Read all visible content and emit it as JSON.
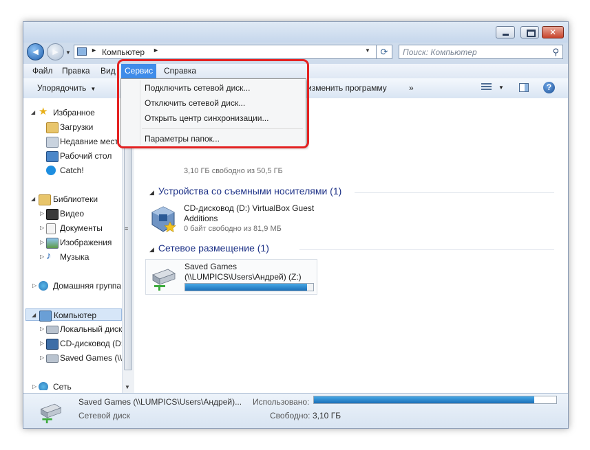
{
  "window": {
    "address": {
      "location": "Компьютер",
      "search_placeholder": "Поиск: Компьютер"
    },
    "menubar": [
      {
        "label": "Файл"
      },
      {
        "label": "Правка"
      },
      {
        "label": "Вид"
      },
      {
        "label": "Сервис",
        "active": true
      },
      {
        "label": "Справка"
      }
    ],
    "toolbar": {
      "organize": "Упорядочить",
      "change_program": "изменить программу",
      "more": "»"
    },
    "service_menu": {
      "items": [
        "Подключить сетевой диск...",
        "Отключить сетевой диск...",
        "Открыть центр синхронизации...",
        "Параметры папок..."
      ]
    },
    "sidebar": {
      "favorites": {
        "label": "Избранное",
        "items": [
          "Загрузки",
          "Недавние мест",
          "Рабочий стол",
          "Catch!"
        ]
      },
      "libraries": {
        "label": "Библиотеки",
        "items": [
          "Видео",
          "Документы",
          "Изображения",
          "Музыка"
        ]
      },
      "homegroup": "Домашняя группа",
      "computer": {
        "label": "Компьютер",
        "items": [
          "Локальный диск",
          "CD-дисковод (D:",
          "Saved Games (\\\\L"
        ]
      },
      "network": "Сеть"
    },
    "content": {
      "hidden_drive_free": "3,10 ГБ свободно из 50,5 ГБ",
      "removable_header": "Устройства со съемными носителями (1)",
      "cd_drive": {
        "name_line1": "CD-дисковод (D:) VirtualBox Guest",
        "name_line2": "Additions",
        "free": "0 байт свободно из 81,9 МБ"
      },
      "network_header": "Сетевое размещение (1)",
      "net_drive": {
        "name_line1": "Saved Games",
        "name_line2": "(\\\\LUMPICS\\Users\\Андрей) (Z:)",
        "used_fraction": 0.95
      }
    },
    "statusbar": {
      "name": "Saved Games (\\\\LUMPICS\\Users\\Андрей)...",
      "type": "Сетевой диск",
      "used_label": "Использовано:",
      "free_label": "Свободно:",
      "free_value": "3,10 ГБ",
      "used_fraction": 0.91
    },
    "colors": {
      "menu_active": "#3f8ce9",
      "highlight": "#e42222",
      "progress": "#1b6fb8"
    }
  }
}
